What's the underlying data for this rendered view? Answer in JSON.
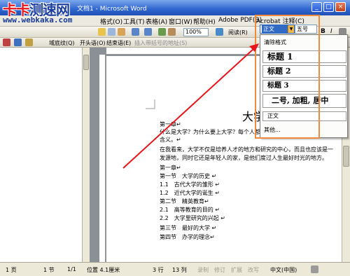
{
  "window": {
    "title": "文档1 - Microsoft Word"
  },
  "logo": {
    "cn_red": "卡卡",
    "cn_blue": "测速网",
    "url": "www.webkaka.com"
  },
  "menu": {
    "items": [
      "格式(O)",
      "工具(T)",
      "表格(A)",
      "窗口(W)",
      "帮助(H)",
      "Adobe PDF(B)"
    ],
    "acrobat": "Acrobat 注释(C)"
  },
  "toolbar1": {
    "zoom": "100%",
    "read_mode": "阅读(R)",
    "bold": "B",
    "italic": "I"
  },
  "toolbar2": {
    "items": [
      "域底纹(Q)",
      "开头语(O)",
      "结束语(E)",
      "插入带括号的地址(S)"
    ]
  },
  "style_combo": {
    "value": "正文",
    "size": "五号"
  },
  "dropdown": {
    "items": [
      {
        "label": "清除格式"
      },
      {
        "label": "标题 1"
      },
      {
        "label": "标题 2"
      },
      {
        "label": "标题 3"
      },
      {
        "label": "二号, 加粗, 居中"
      },
      {
        "label": "正文"
      },
      {
        "label": "其他..."
      }
    ]
  },
  "document": {
    "title": "大学",
    "lines": [
      "第一章↵",
      "什么是大学？为什么要上大学？每个人都",
      "含义。↵",
      "在我看来，大学不仅是培养人才的地方和研究的中心，而且也应该是一",
      "发源地，同时它还是年轻人的家，是他们度过人生最好时光的地方。",
      "第一章↵",
      "第一节　大学的历史 ↵",
      "1.1　古代大学的雏形 ↵",
      "1.2　近代大学的诞生 ↵",
      "第二节　精英教育↵",
      "2.1　高等教育的目的 ↵",
      "2.2　大学里研究的兴起 ↵",
      "第三节　最好的大学 ↵",
      "第四节　办学的理念↵"
    ]
  },
  "status": {
    "page": "1 页",
    "section": "1 节",
    "pages": "1/1",
    "position": "位置 4.1厘米",
    "line": "3 行",
    "col": "13 列",
    "rec": "录制",
    "trk": "修订",
    "ext": "扩展",
    "ovr": "改写",
    "lang": "中文(中国)"
  },
  "colors": {
    "highlight": "#f08a3c",
    "arrow": "#e8161c",
    "title_bar": "#2f66cf"
  }
}
